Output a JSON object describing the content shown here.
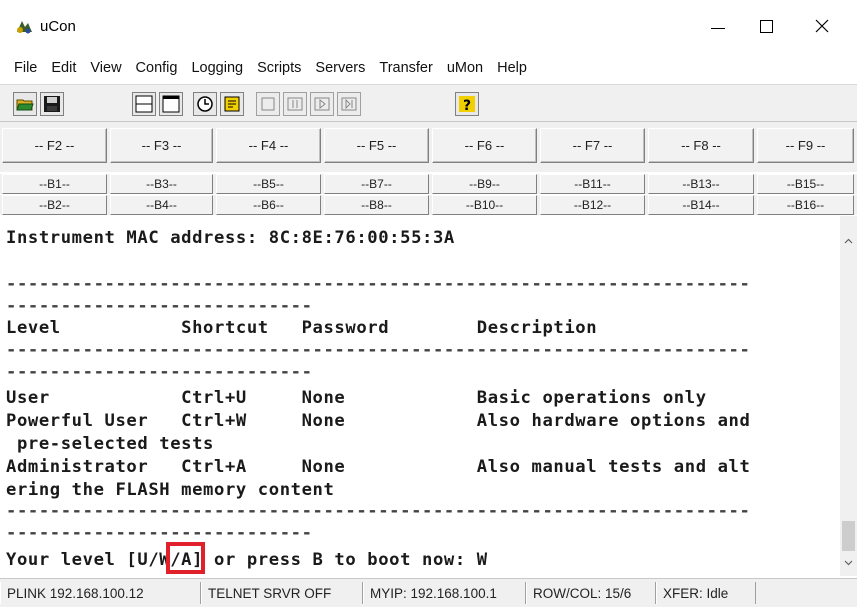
{
  "window": {
    "title": "uCon",
    "minimize_glyph": "—",
    "maximize_glyph": "☐",
    "close_glyph": "✕"
  },
  "menu": [
    "File",
    "Edit",
    "View",
    "Config",
    "Logging",
    "Scripts",
    "Servers",
    "Transfer",
    "uMon",
    "Help"
  ],
  "toolbar": {
    "icons": [
      "open-folder-icon",
      "save-disk-icon",
      "split-window-icon",
      "single-window-icon",
      "clock-icon",
      "script-icon",
      "stop-icon",
      "pause-icon",
      "play-icon",
      "step-icon",
      "help-icon"
    ]
  },
  "fkeys": [
    "-- F2 --",
    "-- F3 --",
    "-- F4 --",
    "-- F5 --",
    "-- F6 --",
    "-- F7 --",
    "-- F8 --",
    "-- F9 --"
  ],
  "brow1": [
    "--B1--",
    "--B3--",
    "--B5--",
    "--B7--",
    "--B9--",
    "--B11--",
    "--B13--",
    "--B15--"
  ],
  "brow2": [
    "--B2--",
    "--B4--",
    "--B6--",
    "--B8--",
    "--B10--",
    "--B12--",
    "--B14--",
    "--B16--"
  ],
  "terminal": {
    "lines": [
      "Instrument MAC address: 8C:8E:76:00:55:3A",
      "",
      "",
      "--------------------------------------------------------------------",
      "----------------------------",
      "Level           Shortcut   Password        Description",
      "--------------------------------------------------------------------",
      "----------------------------",
      "User            Ctrl+U     None            Basic operations only",
      "Powerful User   Ctrl+W     None            Also hardware options and",
      " pre-selected tests",
      "Administrator   Ctrl+A     None            Also manual tests and alt",
      "ering the FLASH memory content",
      "",
      "--------------------------------------------------------------------",
      "----------------------------",
      "Your level [U/W/A] or press B to boot now: W"
    ]
  },
  "status": {
    "plink": "PLINK 192.168.100.12",
    "telnet": "TELNET SRVR OFF",
    "myip": "MYIP: 192.168.100.1",
    "rowcol": "ROW/COL: 15/6",
    "xfer": "XFER: Idle"
  },
  "colors": {
    "highlight": "#e0202a",
    "chrome": "#f0f0f0"
  }
}
